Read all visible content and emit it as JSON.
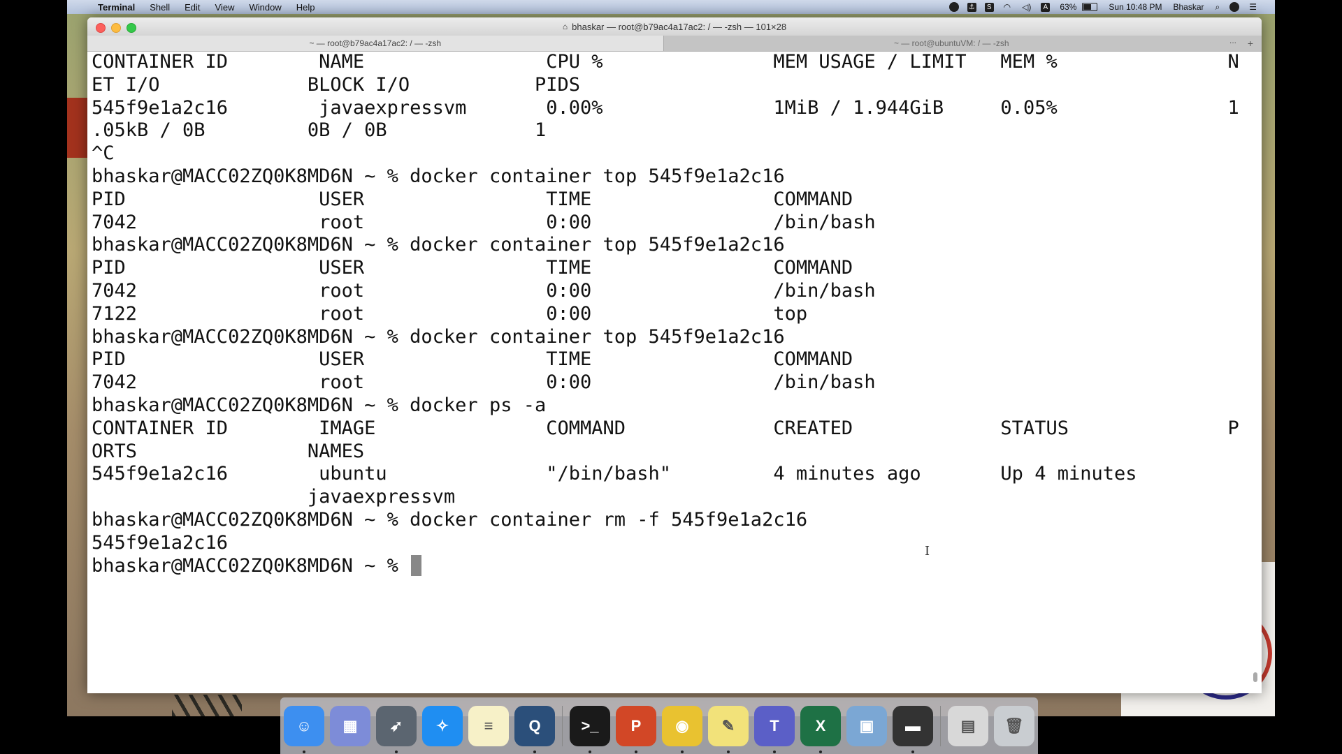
{
  "menubar": {
    "app_name": "Terminal",
    "menus": [
      "Shell",
      "Edit",
      "View",
      "Window",
      "Help"
    ],
    "battery": "63%",
    "clock": "Sun 10:48 PM",
    "user": "Bhaskar"
  },
  "window": {
    "title": "bhaskar — root@b79ac4a17ac2: / — -zsh — 101×28",
    "tabs": [
      {
        "label": "~ — root@b79ac4a17ac2: / — -zsh"
      },
      {
        "label": "~ — root@ubuntuVM: / — -zsh"
      }
    ],
    "tab_more": "...",
    "tab_add": "+"
  },
  "terminal": {
    "lines": [
      "CONTAINER ID        NAME                CPU %               MEM USAGE / LIMIT   MEM %               N",
      "ET I/O             BLOCK I/O           PIDS",
      "545f9e1a2c16        javaexpressvm       0.00%               1MiB / 1.944GiB     0.05%               1",
      ".05kB / 0B         0B / 0B             1",
      "^C",
      "bhaskar@MACC02ZQ0K8MD6N ~ % docker container top 545f9e1a2c16",
      "PID                 USER                TIME                COMMAND",
      "7042                root                0:00                /bin/bash",
      "bhaskar@MACC02ZQ0K8MD6N ~ % docker container top 545f9e1a2c16",
      "PID                 USER                TIME                COMMAND",
      "7042                root                0:00                /bin/bash",
      "7122                root                0:00                top",
      "bhaskar@MACC02ZQ0K8MD6N ~ % docker container top 545f9e1a2c16",
      "PID                 USER                TIME                COMMAND",
      "7042                root                0:00                /bin/bash",
      "bhaskar@MACC02ZQ0K8MD6N ~ % docker ps -a",
      "CONTAINER ID        IMAGE               COMMAND             CREATED             STATUS              P",
      "ORTS               NAMES",
      "545f9e1a2c16        ubuntu              \"/bin/bash\"         4 minutes ago       Up 4 minutes",
      "                   javaexpressvm",
      "bhaskar@MACC02ZQ0K8MD6N ~ % docker container rm -f 545f9e1a2c16",
      "545f9e1a2c16"
    ],
    "prompt": "bhaskar@MACC02ZQ0K8MD6N ~ % "
  },
  "dock": {
    "apps": [
      {
        "name": "Finder",
        "color": "#3d8ff0",
        "glyph": "☺"
      },
      {
        "name": "Launchpad",
        "color": "#7d8cd8",
        "glyph": "▦"
      },
      {
        "name": "Rocket",
        "color": "#5b6570",
        "glyph": "➶"
      },
      {
        "name": "Safari",
        "color": "#1f8ef2",
        "glyph": "✧"
      },
      {
        "name": "Notes",
        "color": "#f7f1c8",
        "glyph": "≡"
      },
      {
        "name": "QuickTime",
        "color": "#2b4f7a",
        "glyph": "Q"
      },
      {
        "name": "Terminal",
        "color": "#1a1a1a",
        "glyph": ">_"
      },
      {
        "name": "PowerPoint",
        "color": "#d24726",
        "glyph": "P"
      },
      {
        "name": "Chrome",
        "color": "#e9c230",
        "glyph": "◉"
      },
      {
        "name": "Stickies",
        "color": "#f2e27a",
        "glyph": "✎"
      },
      {
        "name": "Teams",
        "color": "#5b5fc7",
        "glyph": "T"
      },
      {
        "name": "Excel",
        "color": "#1e7145",
        "glyph": "X"
      },
      {
        "name": "VirtualBox",
        "color": "#7ba7d4",
        "glyph": "▣"
      },
      {
        "name": "Screen Recorder",
        "color": "#333333",
        "glyph": "▬"
      },
      {
        "name": "Documents",
        "color": "#d8d8d8",
        "glyph": "▤"
      },
      {
        "name": "Trash",
        "color": "#c9cdd1",
        "glyph": "🗑"
      }
    ]
  }
}
